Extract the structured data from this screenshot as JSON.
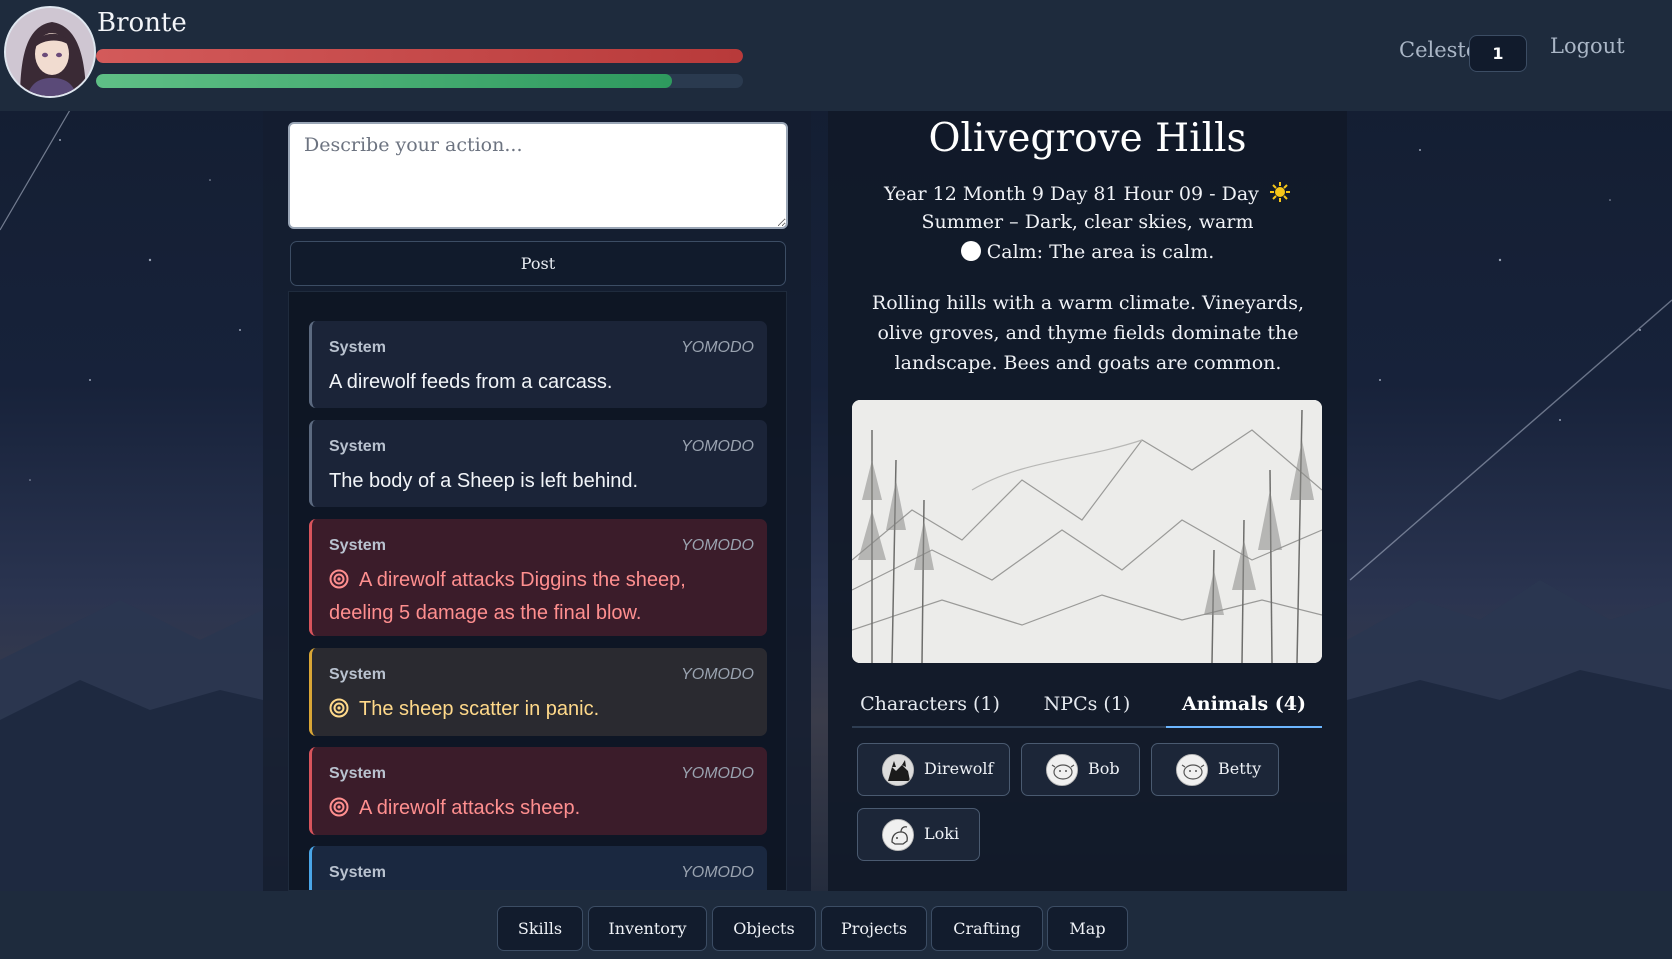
{
  "player": {
    "name": "Bronte",
    "health_fraction": 1.0,
    "stamina_fraction": 0.89
  },
  "header": {
    "character_name": "Celeste",
    "character_count": "1",
    "logout_label": "Logout"
  },
  "composer": {
    "placeholder": "Describe your action...",
    "post_label": "Post"
  },
  "feed": [
    {
      "sender": "System",
      "tag": "YOMODO",
      "text": "A direwolf feeds from a carcass.",
      "kind": "neutral",
      "icon": ""
    },
    {
      "sender": "System",
      "tag": "YOMODO",
      "text": "The body of a Sheep is left behind.",
      "kind": "neutral",
      "icon": ""
    },
    {
      "sender": "System",
      "tag": "YOMODO",
      "text": "A direwolf attacks Diggins the sheep, deeling 5 damage as the final blow.",
      "kind": "danger",
      "icon": "target-icon"
    },
    {
      "sender": "System",
      "tag": "YOMODO",
      "text": "The sheep scatter in panic.",
      "kind": "warning",
      "icon": "target-icon"
    },
    {
      "sender": "System",
      "tag": "YOMODO",
      "text": "A direwolf attacks sheep.",
      "kind": "danger",
      "icon": "target-icon"
    },
    {
      "sender": "System",
      "tag": "YOMODO",
      "text": "",
      "kind": "info",
      "icon": ""
    }
  ],
  "location": {
    "title": "Olivegrove Hills",
    "time_line": "Year 12 Month 9 Day 81 Hour 09 - Day",
    "weather_line": "Summer – Dark, clear skies, warm",
    "calm_line": "Calm: The area is calm.",
    "description": "Rolling hills with a warm climate. Vineyards, olive groves, and thyme fields dominate the landscape. Bees and goats are common."
  },
  "tabs": [
    {
      "label": "Characters (1)",
      "active": false
    },
    {
      "label": "NPCs (1)",
      "active": false
    },
    {
      "label": "Animals (4)",
      "active": true
    }
  ],
  "animals": [
    {
      "name": "Direwolf",
      "icon": "wolf-icon"
    },
    {
      "name": "Bob",
      "icon": "sheep-icon"
    },
    {
      "name": "Betty",
      "icon": "sheep-icon"
    },
    {
      "name": "Loki",
      "icon": "goat-icon"
    }
  ],
  "nav": [
    "Skills",
    "Inventory",
    "Objects",
    "Projects",
    "Crafting",
    "Map"
  ],
  "colors": {
    "health": "#c94545",
    "stamina": "#3fab6e",
    "danger": "#ff8f8f",
    "warning": "#ffd98a",
    "info": "#4aa6e8"
  }
}
